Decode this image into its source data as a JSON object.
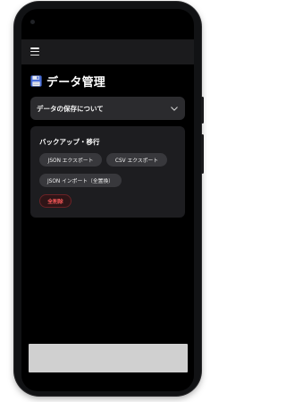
{
  "header": {
    "menu_icon": "hamburger-menu-icon"
  },
  "page": {
    "icon": "floppy-disk-icon",
    "title": "データ管理"
  },
  "accordion": {
    "label": "データの保存について",
    "icon": "chevron-down-icon"
  },
  "backup_card": {
    "title": "バックアップ・移行",
    "buttons": {
      "json_export": "JSON エクスポート",
      "csv_export": "CSV エクスポート",
      "json_import": "JSON インポート（全置換）",
      "delete_all": "全削除"
    }
  },
  "colors": {
    "background": "#000000",
    "card": "#1d1d20",
    "chip": "#38383c",
    "danger_text": "#ff5a5a",
    "bottom_bar": "#d0d0d0"
  }
}
